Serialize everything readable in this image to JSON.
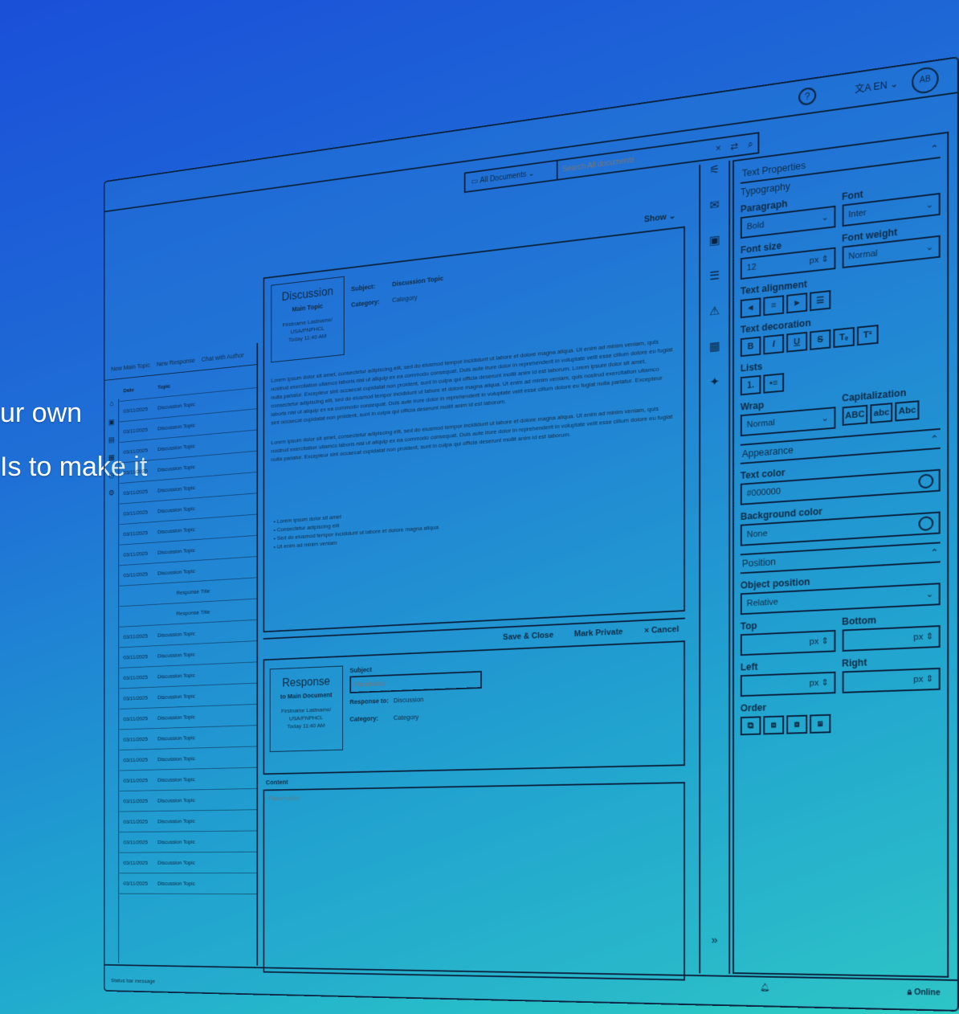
{
  "overlay": {
    "line1": "ur own",
    "line2": "Is to make it"
  },
  "topbar": {
    "help_icon": "?",
    "translate_icon": "translate-icon",
    "language": "EN",
    "avatar": "AB"
  },
  "search": {
    "doc_scope": "All Documents",
    "placeholder": "Search All documents",
    "clear_icon": "×",
    "filter_icon": "⇄",
    "search_icon": "⌕"
  },
  "left_panel": {
    "toolbar": [
      "New Main Topic",
      "New Response",
      "Chat with Author"
    ],
    "columns": [
      "Date",
      "Topic"
    ],
    "rows": [
      {
        "date": "03/11/2025",
        "topic": "Discussion Topic"
      },
      {
        "date": "03/11/2025",
        "topic": "Discussion Topic"
      },
      {
        "date": "03/11/2025",
        "topic": "Discussion Topic"
      },
      {
        "date": "03/11/2025",
        "topic": "Discussion Topic"
      },
      {
        "date": "03/11/2025",
        "topic": "Discussion Topic"
      },
      {
        "date": "03/11/2025",
        "topic": "Discussion Topic"
      },
      {
        "date": "03/11/2025",
        "topic": "Discussion Topic"
      },
      {
        "date": "03/11/2025",
        "topic": "Discussion Topic"
      },
      {
        "date": "03/11/2025",
        "topic": "Discussion Topic"
      },
      {
        "date": "",
        "topic": "Response Title"
      },
      {
        "date": "",
        "topic": "Response Title"
      },
      {
        "date": "03/11/2025",
        "topic": "Discussion Topic"
      },
      {
        "date": "03/11/2025",
        "topic": "Discussion Topic"
      },
      {
        "date": "03/11/2025",
        "topic": "Discussion Topic"
      },
      {
        "date": "03/11/2025",
        "topic": "Discussion Topic"
      },
      {
        "date": "03/11/2025",
        "topic": "Discussion Topic"
      },
      {
        "date": "03/11/2025",
        "topic": "Discussion Topic"
      },
      {
        "date": "03/11/2025",
        "topic": "Discussion Topic"
      },
      {
        "date": "03/11/2025",
        "topic": "Discussion Topic"
      },
      {
        "date": "03/11/2025",
        "topic": "Discussion Topic"
      },
      {
        "date": "03/11/2025",
        "topic": "Discussion Topic"
      },
      {
        "date": "03/11/2025",
        "topic": "Discussion Topic"
      },
      {
        "date": "03/11/2025",
        "topic": "Discussion Topic"
      },
      {
        "date": "03/11/2025",
        "topic": "Discussion Topic"
      }
    ],
    "status": "Status bar message"
  },
  "main": {
    "show_label": "Show",
    "discussion": {
      "title": "Discussion",
      "subtitle": "Main Topic",
      "author": "Firstname Lastname/",
      "org": "USA/PNPHCL",
      "time": "Today 11:40 AM",
      "subject_label": "Subject:",
      "subject_value": "Discussion Topic",
      "category_label": "Category:",
      "category_value": "Category",
      "para1": "Lorem ipsum dolor sit amet, consectetur adipiscing elit, sed do eiusmod tempor incididunt ut labore et dolore magna aliqua. Ut enim ad minim veniam, quis nostrud exercitation ullamco laboris nisi ut aliquip ex ea commodo consequat. Duis aute irure dolor in reprehenderit in voluptate velit esse cillum dolore eu fugiat nulla pariatur. Excepteur sint occaecat cupidatat non proident, sunt in culpa qui officia deserunt mollit anim id est laborum. Lorem ipsum dolor sit amet, consectetur adipiscing elit, sed do eiusmod tempor incididunt ut labore et dolore magna aliqua. Ut enim ad minim veniam, quis nostrud exercitation ullamco laboris nisi ut aliquip ex ea commodo consequat. Duis aute irure dolor in reprehenderit in voluptate velit esse cillum dolore eu fugiat nulla pariatur. Excepteur sint occaecat cupidatat non proident, sunt in culpa qui officia deserunt mollit anim id est laborum.",
      "para2": "Lorem ipsum dolor sit amet, consectetur adipiscing elit, sed do eiusmod tempor incididunt ut labore et dolore magna aliqua. Ut enim ad minim veniam, quis nostrud exercitation ullamco laboris nisi ut aliquip ex ea commodo consequat. Duis aute irure dolor in reprehenderit in voluptate velit esse cillum dolore eu fugiat nulla pariatur. Excepteur sint occaecat cupidatat non proident, sunt in culpa qui officia deserunt mollit anim id est laborum.",
      "bullets": [
        "Lorem ipsum dolor sit amet",
        "Consectetur adipiscing elit",
        "Sed do eiusmod tempor incididunt ut labore et dolore magna aliqua",
        "Ut enim ad minim veniam"
      ]
    },
    "actions": {
      "save": "Save & Close",
      "private": "Mark Private",
      "cancel": "× Cancel"
    },
    "response": {
      "title": "Response",
      "subtitle": "to Main Document",
      "author": "Firstname Lastname/",
      "org": "USA/PNPHCL",
      "time": "Today 11:40 AM",
      "subject_label": "Subject",
      "subject_placeholder": "Placeholder",
      "response_to_label": "Response to:",
      "response_to_value": "Discussion",
      "category_label": "Category:",
      "category_value": "Category"
    },
    "content_label": "Content",
    "content_placeholder": "Placeholder"
  },
  "icon_column": [
    "sliders-icon",
    "comment-icon",
    "archive-icon",
    "chat-icon",
    "warning-icon",
    "calendar-icon",
    "sparkle-icon"
  ],
  "properties": {
    "header": "Text Properties",
    "typography": "Typography",
    "paragraph_label": "Paragraph",
    "paragraph_value": "Bold",
    "font_label": "Font",
    "font_value": "Inter",
    "font_size_label": "Font size",
    "font_size_value": "12",
    "font_size_unit": "px",
    "font_weight_label": "Font weight",
    "font_weight_value": "Normal",
    "text_alignment_label": "Text alignment",
    "text_decoration_label": "Text decoration",
    "decoration_buttons": [
      "B",
      "I",
      "U",
      "S",
      "Tₑ",
      "T²"
    ],
    "lists_label": "Lists",
    "wrap_label": "Wrap",
    "wrap_value": "Normal",
    "capitalization_label": "Capitalization",
    "capitalization_buttons": [
      "ABC",
      "abc",
      "Abc"
    ],
    "appearance": "Appearance",
    "text_color_label": "Text color",
    "text_color_value": "#000000",
    "bg_color_label": "Background color",
    "bg_color_value": "None",
    "position": "Position",
    "object_position_label": "Object position",
    "object_position_value": "Relative",
    "top_label": "Top",
    "bottom_label": "Bottom",
    "left_label": "Left",
    "right_label": "Right",
    "unit": "px",
    "order_label": "Order"
  },
  "footer": {
    "online": "Online"
  }
}
